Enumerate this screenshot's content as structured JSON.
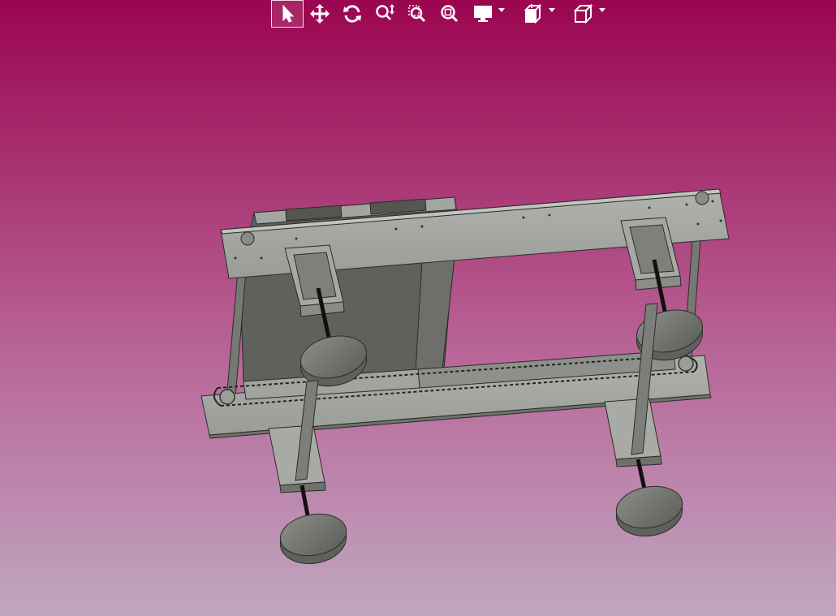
{
  "app": {
    "background_top": "#9b0550",
    "background_bottom": "#c0a6c0"
  },
  "toolbar": {
    "tools": [
      {
        "name": "select-tool",
        "icon": "cursor-arrow-icon",
        "active": true
      },
      {
        "name": "pan-tool",
        "icon": "move-arrows-icon"
      },
      {
        "name": "rotate-tool",
        "icon": "rotate-icon"
      },
      {
        "name": "zoom-tool",
        "icon": "zoom-updown-icon"
      },
      {
        "name": "zoom-window-tool",
        "icon": "zoom-window-icon"
      },
      {
        "name": "zoom-fit-tool",
        "icon": "zoom-fit-icon"
      },
      {
        "name": "display-mode-dropdown",
        "icon": "monitor-icon",
        "dropdown": true
      },
      {
        "name": "section-view-dropdown",
        "icon": "section-cube-icon",
        "dropdown": true
      },
      {
        "name": "view-orientation-dropdown",
        "icon": "cube-icon",
        "dropdown": true
      }
    ]
  },
  "model": {
    "description_colors": {
      "part_light": "#a7a9a4",
      "part_mid": "#8d8f8a",
      "part_dark": "#5a5c57",
      "edge": "#2a2a2a"
    }
  }
}
